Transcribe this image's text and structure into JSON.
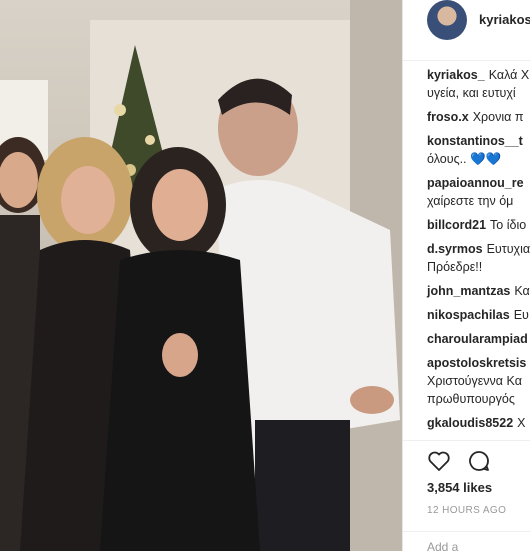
{
  "post": {
    "username": "kyriakos",
    "likes": "3,854 likes",
    "time": "12 HOURS AGO",
    "add_comment": "Add a"
  },
  "comments": [
    {
      "user": "kyriakos_",
      "text": "Καλά Χ",
      "line2": "υγεία, και ευτυχί"
    },
    {
      "user": "froso.x",
      "text": "Χρονια π",
      "line2": ""
    },
    {
      "user": "konstantinos__t",
      "text": "",
      "line2": "όλους.. 💙💙"
    },
    {
      "user": "papaioannou_re",
      "text": "",
      "line2": "χαίρεστε την όμ"
    },
    {
      "user": "billcord21",
      "text": "Το ίδιο",
      "line2": ""
    },
    {
      "user": "d.syrmos",
      "text": "Ευτυχια",
      "line2": "Πρόεδρε!!"
    },
    {
      "user": "john_mantzas",
      "text": "Κα",
      "line2": ""
    },
    {
      "user": "nikospachilas",
      "text": "Ευ",
      "line2": ""
    },
    {
      "user": "charoularampiad",
      "text": "",
      "line2": ""
    },
    {
      "user": "apostoloskretsis",
      "text": "",
      "line2": "Χριστούγεννα Κα"
    },
    {
      "user": "",
      "text": "",
      "line2": "πρωθυπουργός"
    },
    {
      "user": "gkaloudis8522",
      "text": "Χ",
      "line2": ""
    }
  ]
}
